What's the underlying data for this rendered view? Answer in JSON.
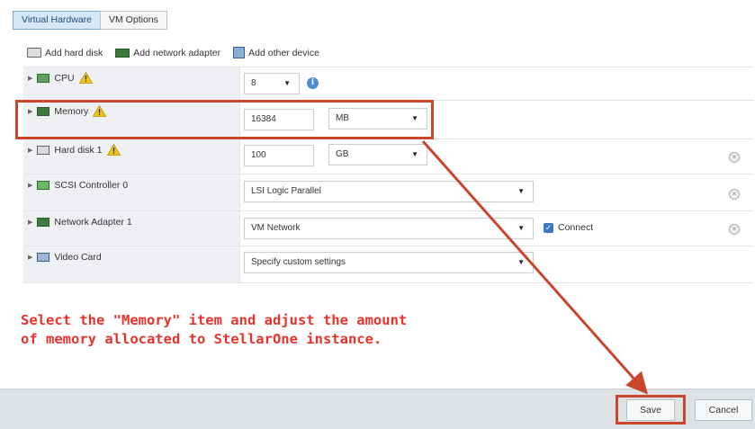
{
  "tabs": [
    {
      "label": "Virtual Hardware",
      "active": true
    },
    {
      "label": "VM Options",
      "active": false
    }
  ],
  "toolbar": {
    "add_hard_disk": "Add hard disk",
    "add_network_adapter": "Add network adapter",
    "add_other_device": "Add other device"
  },
  "devices": {
    "cpu": {
      "label": "CPU",
      "value": "8"
    },
    "memory": {
      "label": "Memory",
      "value": "16384",
      "unit": "MB"
    },
    "hard_disk": {
      "label": "Hard disk 1",
      "value": "100",
      "unit": "GB"
    },
    "scsi": {
      "label": "SCSI Controller 0",
      "value": "LSI Logic Parallel"
    },
    "network": {
      "label": "Network Adapter 1",
      "value": "VM Network",
      "connect_label": "Connect",
      "connected": true
    },
    "video": {
      "label": "Video Card",
      "value": "Specify custom settings"
    }
  },
  "instruction": "Select the \"Memory\" item and adjust the amount\nof memory allocated to StellarOne instance.",
  "footer": {
    "save": "Save",
    "cancel": "Cancel"
  },
  "colors": {
    "annotation": "#c9462d",
    "instruction_text": "#e8332b",
    "accent": "#4d8fd1"
  }
}
